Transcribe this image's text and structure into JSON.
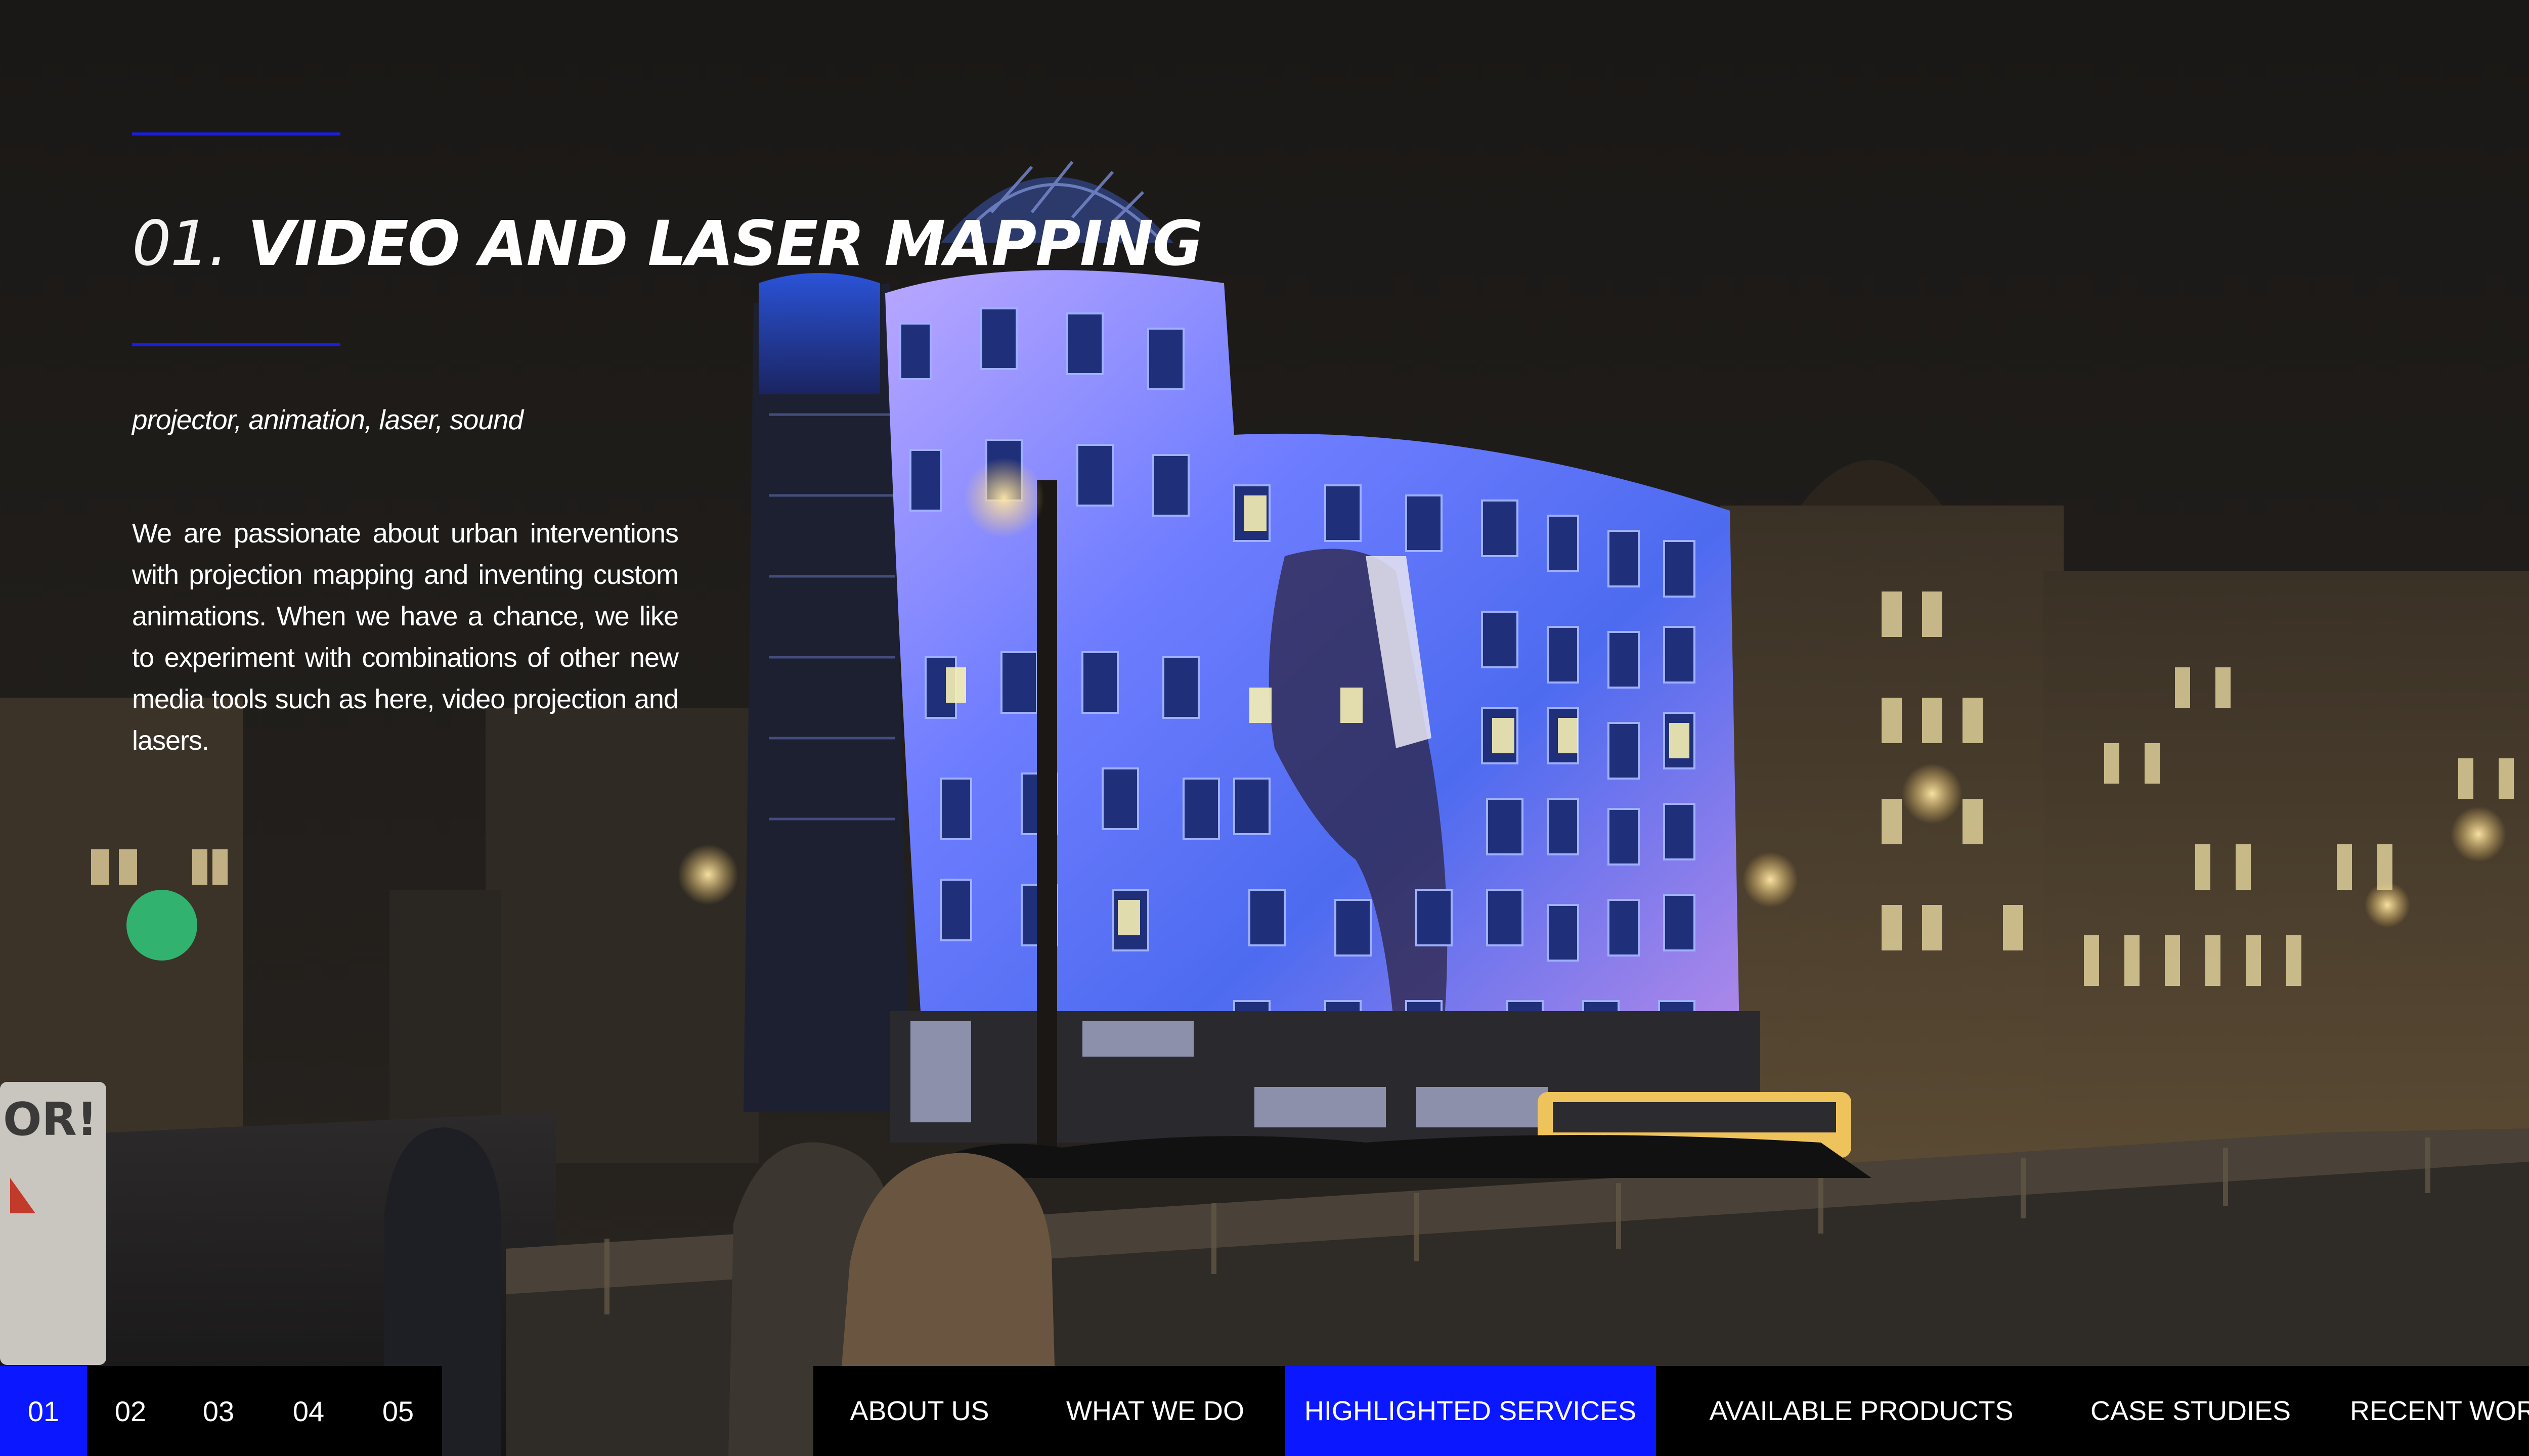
{
  "hero": {
    "number": "01.",
    "title": "VIDEO AND LASER MAPPING",
    "tags": "projector, animation, laser, sound",
    "description": "We are passionate about urban interventions with projection mapping and inventing custom animations. When we have a chance, we like to experiment with combinations of other new media tools such as here, video projection and lasers.",
    "sign_text": "OR!"
  },
  "pager": {
    "items": [
      "01",
      "02",
      "03",
      "04",
      "05"
    ],
    "active_index": 0
  },
  "menu": {
    "items": [
      "ABOUT US",
      "WHAT WE DO",
      "HIGHLIGHTED SERVICES",
      "AVAILABLE PRODUCTS",
      "CASE STUDIES",
      "RECENT WORK"
    ],
    "active_index": 2
  },
  "colors": {
    "accent": "#0a17ff",
    "rule": "#1a1ee0",
    "nav_background": "#000000",
    "text": "#ffffff",
    "projection_blue": "#6a7cff",
    "projection_purple": "#a87de8",
    "window_light": "#e8d8a0"
  }
}
